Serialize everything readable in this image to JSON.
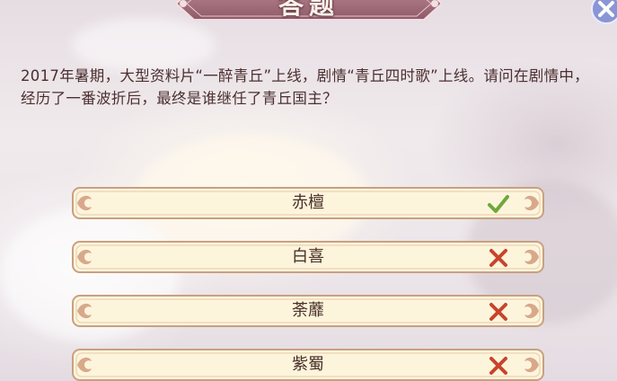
{
  "header": {
    "title": "答题"
  },
  "question": {
    "text": "2017年暑期，大型资料片“一醉青丘”上线，剧情“青丘四时歌”上线。请问在剧情中，经历了一番波折后，最终是谁继任了青丘国主？"
  },
  "options": [
    {
      "label": "赤檀",
      "result_icon": "check-icon"
    },
    {
      "label": "白喜",
      "result_icon": "cross-icon"
    },
    {
      "label": "荼蘼",
      "result_icon": "cross-icon"
    },
    {
      "label": "紫蜀",
      "result_icon": "cross-icon"
    }
  ],
  "colors": {
    "option_fill": "#fdf4dc",
    "option_border": "#c9a081",
    "check": "#6ea83a",
    "cross": "#c8442a",
    "banner": "#a36b79",
    "text": "#4a3128"
  }
}
